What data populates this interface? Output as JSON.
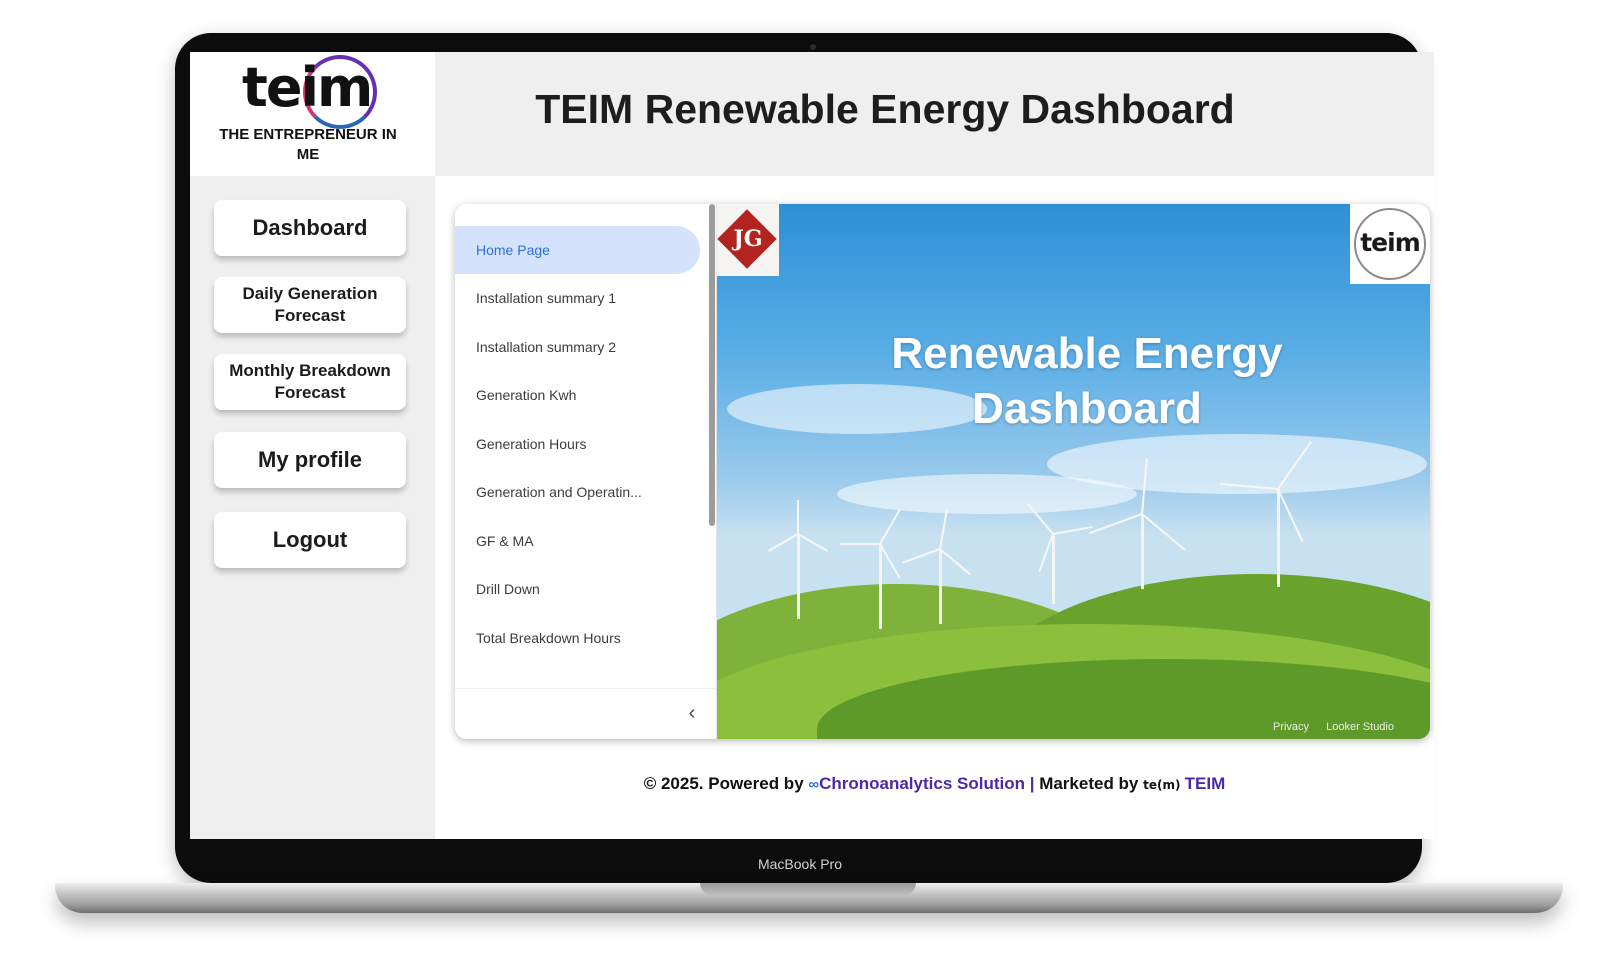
{
  "logo": {
    "wordmark": "teim",
    "caption": "THE ENTREPRENEUR IN ME"
  },
  "header": {
    "title": "TEIM Renewable Energy Dashboard",
    "profile_icon": "user-circle-icon"
  },
  "sidebar": {
    "items": [
      {
        "label": "Dashboard"
      },
      {
        "label": "Daily Generation Forecast"
      },
      {
        "label": "Monthly Breakdown Forecast"
      },
      {
        "label": "My profile"
      },
      {
        "label": "Logout"
      }
    ]
  },
  "report": {
    "pages": [
      {
        "label": "Home Page",
        "active": true
      },
      {
        "label": "Installation summary 1"
      },
      {
        "label": "Installation summary 2"
      },
      {
        "label": "Generation Kwh"
      },
      {
        "label": "Generation Hours"
      },
      {
        "label": "Generation and Operatin..."
      },
      {
        "label": "GF & MA"
      },
      {
        "label": "Drill Down"
      },
      {
        "label": "Total Breakdown Hours"
      }
    ],
    "collapse_icon": "chevron-left-icon",
    "hero_title": "Renewable Energy Dashboard",
    "left_badge_text": "JG",
    "right_badge_text": "teim",
    "footer_links": [
      "Privacy",
      "Looker Studio"
    ]
  },
  "footer": {
    "prefix": "© 2025. Powered by ",
    "company": "Chronoanalytics Solution",
    "separator": " | ",
    "marketed_by": "Marketed by ",
    "brand": "TEIM"
  },
  "device": {
    "label": "MacBook Pro"
  },
  "colors": {
    "accent": "#4b2aa8",
    "active_page_bg": "#d4e3fb",
    "active_page_text": "#2f6fd6",
    "panel_bg": "#f0efef"
  }
}
